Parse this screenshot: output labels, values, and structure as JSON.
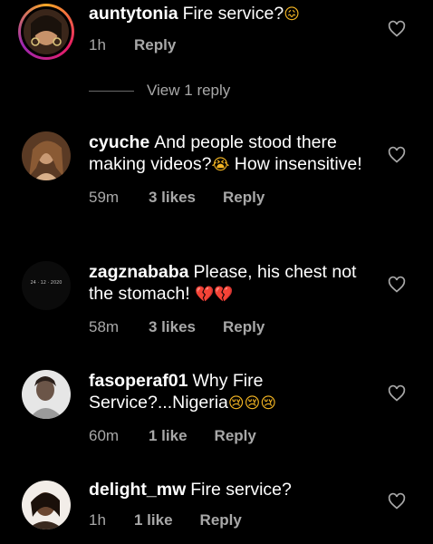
{
  "comments": [
    {
      "username": "auntytonia",
      "text": "Fire service?",
      "emoji": "😖",
      "time": "1h",
      "likes": "",
      "reply_label": "Reply",
      "view_replies": "View 1 reply",
      "avatar_colors": [
        "#2a1b12",
        "#c98f5c"
      ]
    },
    {
      "username": "cyuche",
      "text": "And people stood there making videos?",
      "emoji": "😭",
      "text_after": " How insensitive!",
      "time": "59m",
      "likes": "3 likes",
      "reply_label": "Reply",
      "avatar_colors": [
        "#3d2a1e",
        "#b07a50"
      ]
    },
    {
      "username": "zagznababa",
      "text": "Please, his chest not the stomach!",
      "emoji": "💔💔",
      "time": "58m",
      "likes": "3 likes",
      "reply_label": "Reply",
      "avatar_caption": "24 · 12 · 2020"
    },
    {
      "username": "fasoperaf01",
      "text": "Why Fire Service?...Nigeria",
      "emoji": "😢😢😢",
      "time": "60m",
      "likes": "1 like",
      "reply_label": "Reply",
      "avatar_colors": [
        "#6a6a6a",
        "#d9d9d9"
      ]
    },
    {
      "username": "delight_mw",
      "text": "Fire service?",
      "emoji": "",
      "time": "1h",
      "likes": "1 like",
      "reply_label": "Reply",
      "avatar_colors": [
        "#1b130d",
        "#8a5a3a"
      ]
    }
  ]
}
